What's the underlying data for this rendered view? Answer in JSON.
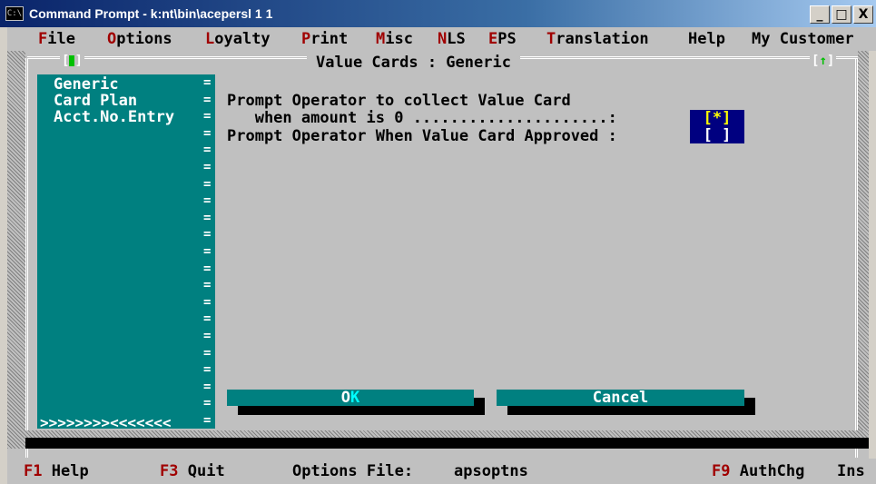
{
  "window": {
    "title": "Command Prompt - k:nt\\bin\\acepersl 1 1",
    "icon": "console-icon",
    "icon_glyph": "C:\\",
    "buttons": {
      "minimize": "_",
      "maximize": "□",
      "close": "X"
    }
  },
  "menubar": {
    "items": [
      {
        "hotkey": "F",
        "rest": "ile"
      },
      {
        "hotkey": "O",
        "rest": "ptions"
      },
      {
        "hotkey": "L",
        "rest": "oyalty"
      },
      {
        "hotkey": "P",
        "rest": "rint"
      },
      {
        "hotkey": "M",
        "rest": "isc"
      },
      {
        "hotkey": "N",
        "rest": "LS"
      },
      {
        "hotkey": "E",
        "rest": "PS"
      },
      {
        "hotkey": "T",
        "rest": "ranslation"
      },
      {
        "hotkey": "",
        "rest": "Help"
      },
      {
        "hotkey": "",
        "rest": "My Customer"
      }
    ]
  },
  "dialog": {
    "title": "Value Cards : Generic",
    "close_glyph_left": "[",
    "close_glyph_right": "]",
    "zoom_glyph_left": "[",
    "zoom_glyph_arrow": "↑",
    "zoom_glyph_right": "]"
  },
  "sidebar": {
    "items": [
      {
        "label": "Generic",
        "selected": true
      },
      {
        "label": "Card Plan",
        "selected": false
      },
      {
        "label": "Acct.No.Entry",
        "selected": false
      }
    ],
    "separator_glyph": "=",
    "footer": ">>>>>>>><<<<<<<"
  },
  "fields": {
    "collect_line1": "Prompt Operator to collect Value Card",
    "collect_line2": "   when amount is 0 .....................:",
    "collect_value": "[*]",
    "approved_label": "Prompt Operator When Value Card Approved :",
    "approved_value": "[ ]"
  },
  "buttons": {
    "ok": {
      "prefix": "O",
      "hot": "K"
    },
    "cancel": "Cancel"
  },
  "statusbar": {
    "f1_key": "F1",
    "f1_label": "Help",
    "f3_key": "F3",
    "f3_label": "Quit",
    "options_label": "Options File:",
    "options_value": "apsoptns",
    "f9_key": "F9",
    "f9_label": "AuthChg",
    "mode": "Ins"
  },
  "colors": {
    "console_bg": "#c0c0c0",
    "teal": "#008080",
    "hotkey_red": "#a00000",
    "field_bg": "#000080",
    "checked_yellow": "#ffff00"
  }
}
